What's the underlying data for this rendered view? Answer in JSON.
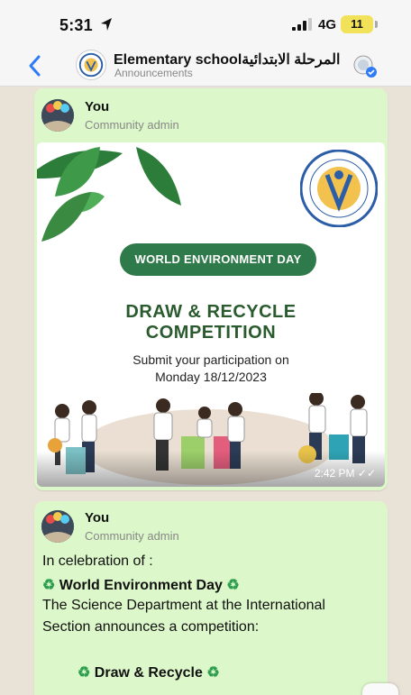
{
  "status_bar": {
    "time": "5:31",
    "network": "4G",
    "battery": "11"
  },
  "header": {
    "title": "Elementary schoolالمرحلة الابتدائية",
    "subtitle": "Announcements"
  },
  "messages": [
    {
      "sender": "You",
      "role": "Community admin",
      "image": {
        "banner": "WORLD ENVIRONMENT DAY",
        "title_line_1": "DRAW & RECYCLE",
        "title_line_2": "COMPETITION",
        "sub_line_1": "Submit your participation on",
        "sub_line_2": "Monday 18/12/2023",
        "time": "2:42 PM"
      }
    },
    {
      "sender": "You",
      "role": "Community admin",
      "lines": {
        "l1": "In celebration of :",
        "l2": "World Environment Day",
        "l3": "The  Science Department at the International",
        "l4": "Section announces a competition:",
        "l5": "Draw & Recycle"
      }
    }
  ],
  "icons": {
    "recycle": "♻",
    "back": "chevron-left-icon",
    "read_receipt": "✓✓"
  },
  "colors": {
    "bubble": "#dcf7c9",
    "banner_green": "#2f7a4a",
    "title_green": "#2a5a2e",
    "ios_blue": "#2f7bf6"
  }
}
